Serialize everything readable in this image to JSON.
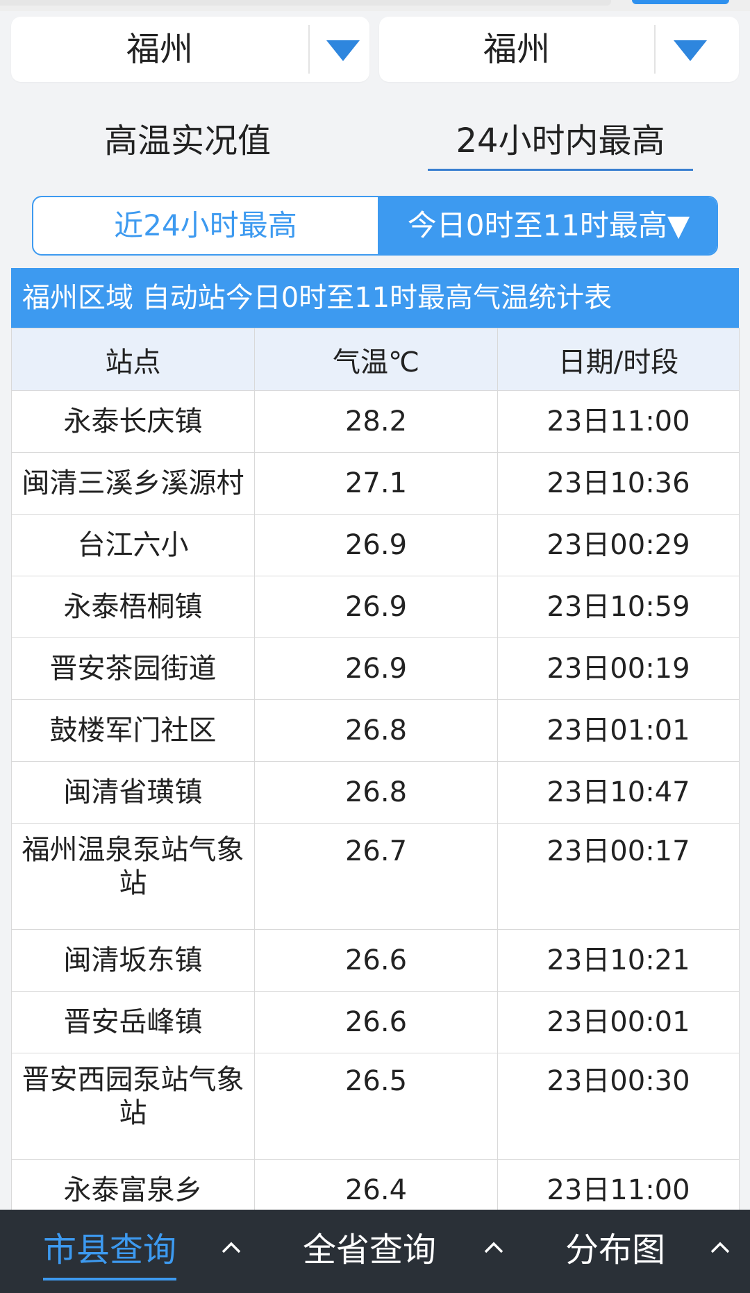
{
  "selects": [
    {
      "value": "福州"
    },
    {
      "value": "福州"
    }
  ],
  "tabs": [
    {
      "label": "高温实况值"
    },
    {
      "label": "24小时内最高"
    }
  ],
  "segment": {
    "left": "近24小时最高",
    "right": "今日0时至11时最高▼"
  },
  "table": {
    "caption": "福州区域 自动站今日0时至11时最高气温统计表",
    "headers": [
      "站点",
      "气温℃",
      "日期/时段"
    ],
    "rows": [
      [
        "永泰长庆镇",
        "28.2",
        "23日11:00"
      ],
      [
        "闽清三溪乡溪源村",
        "27.1",
        "23日10:36"
      ],
      [
        "台江六小",
        "26.9",
        "23日00:29"
      ],
      [
        "永泰梧桐镇",
        "26.9",
        "23日10:59"
      ],
      [
        "晋安茶园街道",
        "26.9",
        "23日00:19"
      ],
      [
        "鼓楼军门社区",
        "26.8",
        "23日01:01"
      ],
      [
        "闽清省璜镇",
        "26.8",
        "23日10:47"
      ],
      [
        "福州温泉泵站气象站",
        "26.7",
        "23日00:17"
      ],
      [
        "闽清坂东镇",
        "26.6",
        "23日10:21"
      ],
      [
        "晋安岳峰镇",
        "26.6",
        "23日00:01"
      ],
      [
        "晋安西园泵站气象站",
        "26.5",
        "23日00:30"
      ],
      [
        "永泰富泉乡",
        "26.4",
        "23日11:00"
      ]
    ]
  },
  "bottom_nav": [
    {
      "label": "市县查询"
    },
    {
      "label": "全省查询"
    },
    {
      "label": "分布图"
    }
  ],
  "colors": {
    "accent": "#3d9af0",
    "nav_bg": "#2a3037",
    "page_bg": "#f2f3f5",
    "header_bg": "#e9f0fa"
  },
  "icons": [
    "dropdown-triangle-icon",
    "chevron-up-icon"
  ]
}
